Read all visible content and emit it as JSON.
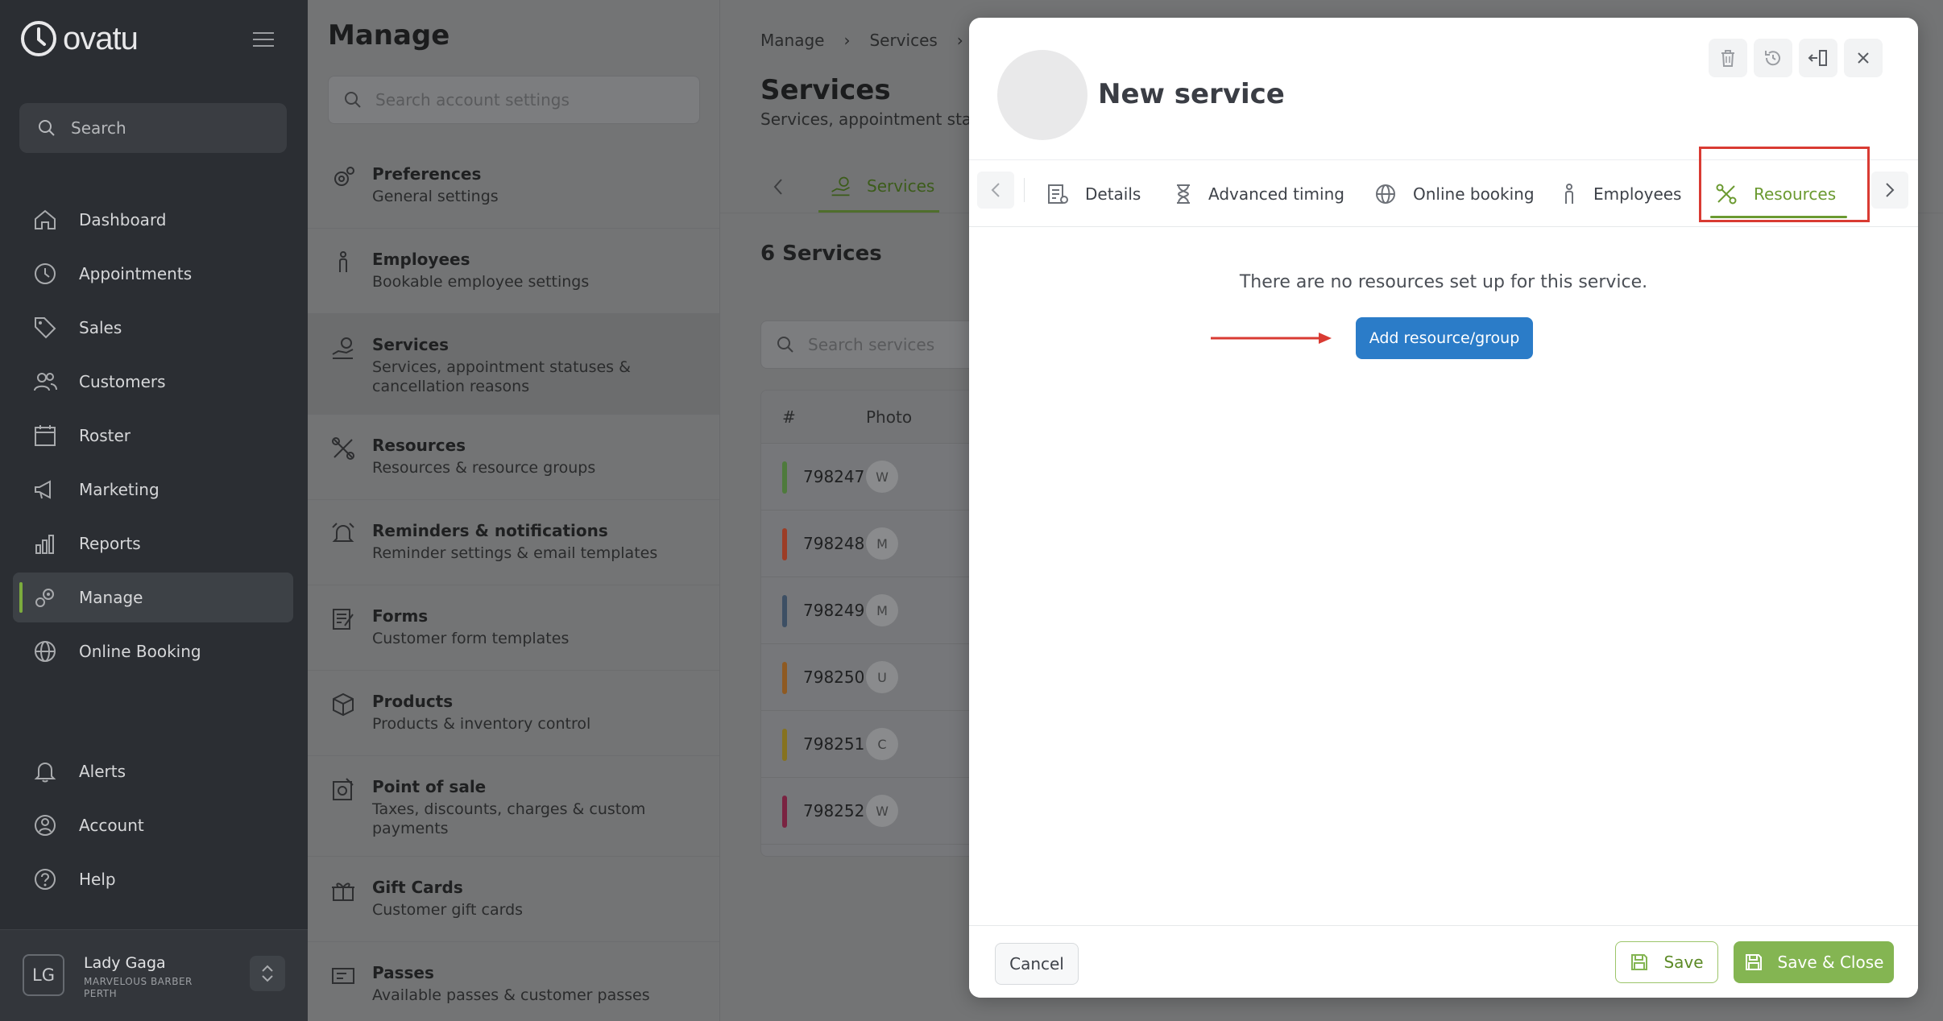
{
  "app": {
    "logo_text": "ovatu",
    "search_placeholder": "Search",
    "accent_color": "#7cab3d",
    "nav": [
      {
        "label": "Dashboard",
        "icon": "home-icon"
      },
      {
        "label": "Appointments",
        "icon": "clock-icon"
      },
      {
        "label": "Sales",
        "icon": "tag-icon"
      },
      {
        "label": "Customers",
        "icon": "users-icon"
      },
      {
        "label": "Roster",
        "icon": "calendar-icon"
      },
      {
        "label": "Marketing",
        "icon": "megaphone-icon"
      },
      {
        "label": "Reports",
        "icon": "chart-icon"
      },
      {
        "label": "Manage",
        "icon": "gears-icon",
        "active": true
      },
      {
        "label": "Online Booking",
        "icon": "globe-icon"
      }
    ],
    "nav_bottom": [
      {
        "label": "Alerts",
        "icon": "bell-icon"
      },
      {
        "label": "Account",
        "icon": "account-icon"
      },
      {
        "label": "Help",
        "icon": "help-icon"
      }
    ],
    "user": {
      "initials": "LG",
      "name": "Lady Gaga",
      "business": "MARVELOUS BARBER PERTH"
    }
  },
  "settings": {
    "title": "Manage",
    "search_placeholder": "Search account settings",
    "items": [
      {
        "title": "Preferences",
        "subtitle": "General settings",
        "icon": "preferences-icon"
      },
      {
        "title": "Employees",
        "subtitle": "Bookable employee settings",
        "icon": "employee-icon"
      },
      {
        "title": "Services",
        "subtitle": "Services, appointment statuses & cancellation reasons",
        "icon": "services-icon",
        "active": true
      },
      {
        "title": "Resources",
        "subtitle": "Resources & resource groups",
        "icon": "resources-icon"
      },
      {
        "title": "Reminders & notifications",
        "subtitle": "Reminder settings & email templates",
        "icon": "alarm-icon"
      },
      {
        "title": "Forms",
        "subtitle": "Customer form templates",
        "icon": "forms-icon"
      },
      {
        "title": "Products",
        "subtitle": "Products & inventory control",
        "icon": "box-icon"
      },
      {
        "title": "Point of sale",
        "subtitle": "Taxes, discounts, charges & custom payments",
        "icon": "pos-icon"
      },
      {
        "title": "Gift Cards",
        "subtitle": "Customer gift cards",
        "icon": "gift-icon"
      },
      {
        "title": "Passes",
        "subtitle": "Available passes & customer passes",
        "icon": "pass-icon"
      }
    ]
  },
  "main": {
    "breadcrumb": [
      "Manage",
      "Services"
    ],
    "title": "Services",
    "subtitle": "Services, appointment status",
    "tab_label": "Services",
    "count": "6 Services",
    "search_placeholder": "Search services",
    "table_headers": [
      "#",
      "Photo"
    ],
    "rows": [
      {
        "id": "798247",
        "initial": "W",
        "color": "#4e7a3c"
      },
      {
        "id": "798248",
        "initial": "M",
        "color": "#9c3d26"
      },
      {
        "id": "798249",
        "initial": "M",
        "color": "#3d4f64"
      },
      {
        "id": "798250",
        "initial": "U",
        "color": "#8e5a22"
      },
      {
        "id": "798251",
        "initial": "C",
        "color": "#86721f"
      },
      {
        "id": "798252",
        "initial": "W",
        "color": "#7a2341"
      }
    ]
  },
  "modal": {
    "title": "New service",
    "tabs": [
      {
        "label": "Details",
        "icon": "details-icon"
      },
      {
        "label": "Advanced timing",
        "icon": "hourglass-icon"
      },
      {
        "label": "Online booking",
        "icon": "globe-icon"
      },
      {
        "label": "Employees",
        "icon": "employee-icon"
      },
      {
        "label": "Resources",
        "icon": "resources-icon",
        "active": true
      }
    ],
    "empty_message": "There are no resources set up for this service.",
    "add_button": "Add resource/group",
    "cancel": "Cancel",
    "save": "Save",
    "save_close": "Save & Close",
    "highlight_color": "#d93b33",
    "primary_color": "#2b7cc8"
  }
}
